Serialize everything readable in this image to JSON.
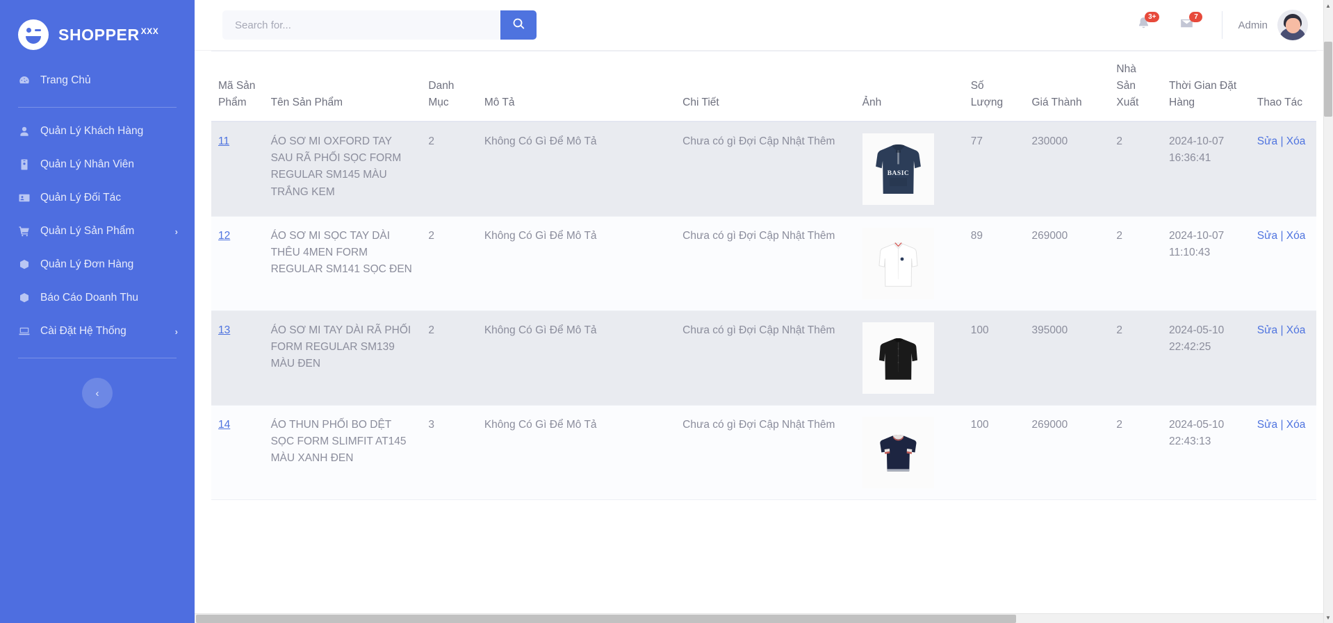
{
  "brand": {
    "name": "SHOPPER",
    "suffix": "XXX",
    "logo_icon": "wink-smiley-icon"
  },
  "sidebar": {
    "items": [
      {
        "label": "Trang Chủ",
        "icon": "dashboard-icon",
        "expandable": false
      },
      {
        "label": "Quản Lý Khách Hàng",
        "icon": "user-icon",
        "expandable": false
      },
      {
        "label": "Quản Lý Nhân Viên",
        "icon": "id-badge-icon",
        "expandable": false
      },
      {
        "label": "Quản Lý Đối Tác",
        "icon": "contact-card-icon",
        "expandable": false
      },
      {
        "label": "Quản Lý Sản Phẩm",
        "icon": "cart-icon",
        "expandable": true,
        "chevron": "›"
      },
      {
        "label": "Quản Lý Đơn Hàng",
        "icon": "box-icon",
        "expandable": false
      },
      {
        "label": "Báo Cáo Doanh Thu",
        "icon": "box-icon",
        "expandable": false
      },
      {
        "label": "Cài Đặt Hệ Thống",
        "icon": "laptop-icon",
        "expandable": true,
        "chevron": "›"
      }
    ],
    "collapse_label": "‹"
  },
  "topbar": {
    "search": {
      "placeholder": "Search for...",
      "value": "",
      "button_icon": "search-icon"
    },
    "alerts": {
      "icon": "bell-icon",
      "badge": "3+"
    },
    "messages": {
      "icon": "envelope-icon",
      "badge": "7"
    },
    "user": {
      "name": "Admin",
      "avatar_icon": "avatar-icon"
    }
  },
  "table": {
    "headers": [
      "Mã Sản Phẩm",
      "Tên Sản Phẩm",
      "Danh Mục",
      "Mô Tả",
      "Chi Tiết",
      "Ảnh",
      "Số Lượng",
      "Giá Thành",
      "Nhà Sản Xuất",
      "Thời Gian Đặt Hàng",
      "Thao Tác"
    ],
    "action_edit": "Sửa",
    "action_sep": "|",
    "action_delete": "Xóa",
    "rows": [
      {
        "id": "11",
        "name": "ÁO SƠ MI OXFORD TAY SAU RÃ PHỐI SỌC FORM REGULAR SM145 MÀU TRẮNG KEM",
        "category": "2",
        "description": "Không Có Gì Để Mô Tả",
        "detail": "Chưa có gì Đợi Cập Nhật Thêm",
        "image": "navy-basic-hoodie",
        "quantity": "77",
        "price": "230000",
        "manufacturer": "2",
        "order_time": "2024-10-07 16:36:41"
      },
      {
        "id": "12",
        "name": "ÁO SƠ MI SỌC TAY DÀI THÊU 4MEN FORM REGULAR SM141 SỌC ĐEN",
        "category": "2",
        "description": "Không Có Gì Để Mô Tả",
        "detail": "Chưa có gì Đợi Cập Nhật Thêm",
        "image": "white-long-sleeve-shirt",
        "quantity": "89",
        "price": "269000",
        "manufacturer": "2",
        "order_time": "2024-10-07 11:10:43"
      },
      {
        "id": "13",
        "name": "ÁO SƠ MI TAY DÀI RÃ PHỐI FORM REGULAR SM139 MÀU ĐEN",
        "category": "2",
        "description": "Không Có Gì Để Mô Tả",
        "detail": "Chưa có gì Đợi Cập Nhật Thêm",
        "image": "black-long-sleeve-shirt",
        "quantity": "100",
        "price": "395000",
        "manufacturer": "2",
        "order_time": "2024-05-10 22:42:25"
      },
      {
        "id": "14",
        "name": "ÁO THUN PHỐI BO DỆT SỌC FORM SLIMFIT AT145 MÀU XANH ĐEN",
        "category": "3",
        "description": "Không Có Gì Để Mô Tả",
        "detail": "Chưa có gì Đợi Cập Nhật Thêm",
        "image": "navy-striped-tshirt",
        "quantity": "100",
        "price": "269000",
        "manufacturer": "2",
        "order_time": "2024-05-10 22:43:13"
      }
    ]
  },
  "colors": {
    "sidebar": "#4e6ee0",
    "accent": "#4e73df",
    "badge": "#e74a3b",
    "row_odd": "#e9ebf0",
    "row_even": "#fbfcfe"
  }
}
